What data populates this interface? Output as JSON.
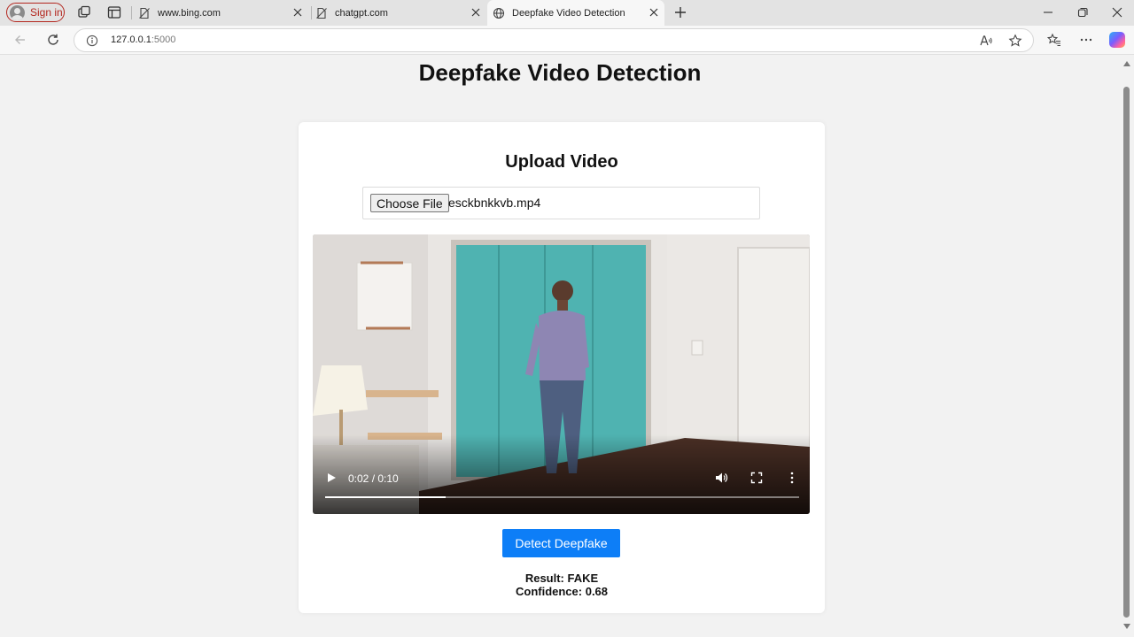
{
  "browser": {
    "signin_label": "Sign in",
    "tabs": [
      {
        "title": "www.bing.com"
      },
      {
        "title": "chatgpt.com"
      },
      {
        "title": "Deepfake Video Detection"
      }
    ],
    "url_host": "127.0.0.1",
    "url_port": ":5000"
  },
  "page": {
    "title": "Deepfake Video Detection",
    "upload_heading": "Upload Video",
    "file_button": "Choose File",
    "file_name": "esckbnkkvb.mp4",
    "video": {
      "time_display": "0:02 / 0:10",
      "progress_fraction": 0.255
    },
    "detect_button": "Detect Deepfake",
    "result_line": "Result: FAKE",
    "confidence_line": "Confidence: 0.68"
  },
  "colors": {
    "accent": "#0d7ef7",
    "signin": "#b3261e",
    "page_bg": "#f2f2f2"
  },
  "icons": [
    "profile-icon",
    "workspaces-icon",
    "tab-actions-icon",
    "page-icon",
    "globe-icon",
    "close-icon",
    "new-tab-icon",
    "minimize-icon",
    "restore-icon",
    "window-close-icon",
    "back-icon",
    "refresh-icon",
    "info-icon",
    "read-aloud-icon",
    "favorite-icon",
    "favorites-icon",
    "more-icon",
    "copilot-icon",
    "play-icon",
    "volume-icon",
    "fullscreen-icon",
    "kebab-icon"
  ]
}
